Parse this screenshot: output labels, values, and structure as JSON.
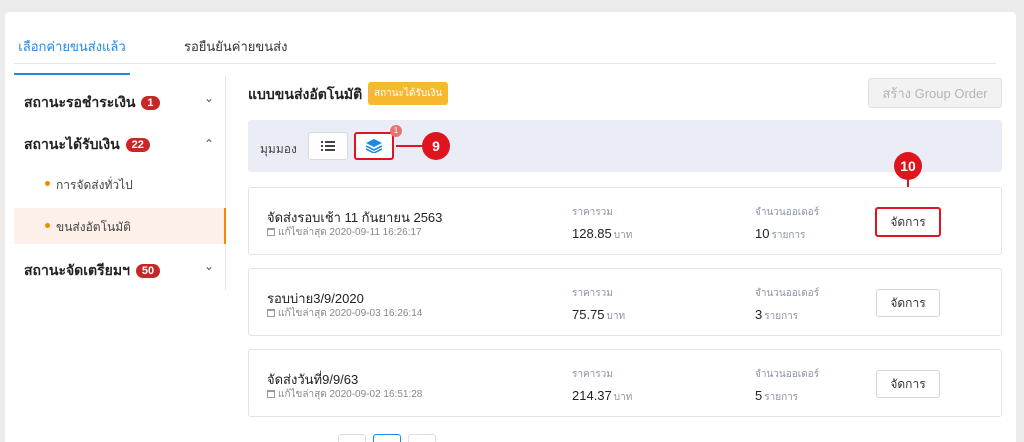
{
  "tabs": [
    {
      "label": "เลือกค่ายขนส่งแล้ว"
    },
    {
      "label": "รอยืนยันค่ายขนส่ง"
    }
  ],
  "sidebar": {
    "groups": [
      {
        "label": "สถานะรอชำระเงิน",
        "count": "1",
        "expanded": false
      },
      {
        "label": "สถานะได้รับเงิน",
        "count": "22",
        "expanded": true
      },
      {
        "label": "สถานะจัดเตรียมฯ",
        "count": "50",
        "expanded": false
      }
    ],
    "subitems": [
      {
        "label": "การจัดส่งทั่วไป",
        "active": false
      },
      {
        "label": "ขนส่งอัตโนมัติ",
        "active": true
      }
    ]
  },
  "main": {
    "title": "แบบขนส่งอัตโนมัติ",
    "status_tag": "สถานะได้รับเงิน",
    "create_button": "สร้าง Group Order",
    "view_label": "มุมมอง",
    "view_notification": "1"
  },
  "callouts": {
    "view": "9",
    "manage": "10"
  },
  "orders": [
    {
      "name": "จัดส่งรอบเช้า 11 กันยายน 2563",
      "edited": "แก้ไขล่าสุด 2020-09-11 16:26:17",
      "price_label": "ราคารวม",
      "price": "128.85",
      "price_unit": "บาท",
      "qty_label": "จำนวนออเดอร์",
      "qty": "10",
      "qty_unit": "รายการ",
      "action": "จัดการ"
    },
    {
      "name": "รอบบ่าย3/9/2020",
      "edited": "แก้ไขล่าสุด 2020-09-03 16:26:14",
      "price_label": "ราคารวม",
      "price": "75.75",
      "price_unit": "บาท",
      "qty_label": "จำนวนออเดอร์",
      "qty": "3",
      "qty_unit": "รายการ",
      "action": "จัดการ"
    },
    {
      "name": "จัดส่งวันที่9/9/63",
      "edited": "แก้ไขล่าสุด 2020-09-02 16:51:28",
      "price_label": "ราคารวม",
      "price": "214.37",
      "price_unit": "บาท",
      "qty_label": "จำนวนออเดอร์",
      "qty": "5",
      "qty_unit": "รายการ",
      "action": "จัดการ"
    }
  ],
  "colors": {
    "accent": "#1e88e5",
    "badge": "#c62828",
    "highlight": "#e0141e",
    "tag": "#f5b82e",
    "active_sub": "#f08a00"
  },
  "icons": {
    "list_view": "list-icon",
    "group_view": "layers-icon",
    "date": "calendar-icon"
  }
}
